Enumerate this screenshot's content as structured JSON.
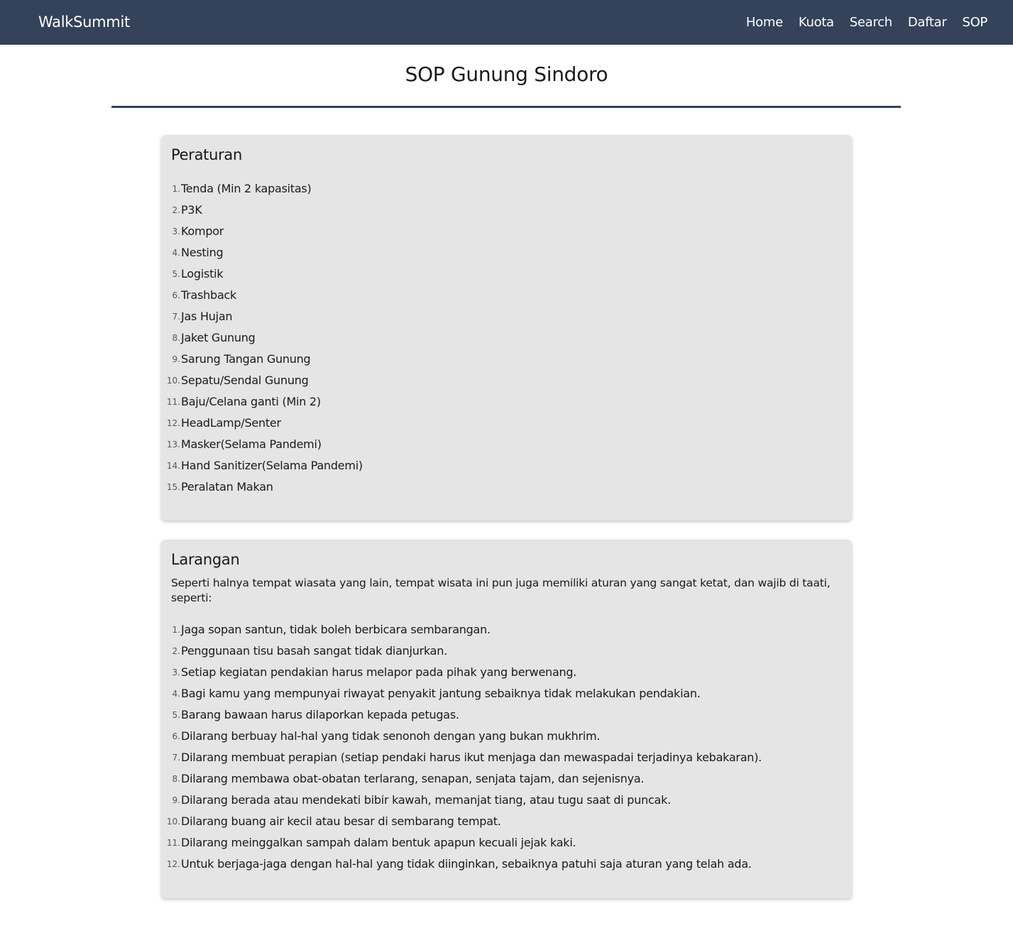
{
  "navbar": {
    "brand": "WalkSummit",
    "links": [
      "Home",
      "Kuota",
      "Search",
      "Daftar",
      "SOP"
    ]
  },
  "page": {
    "title": "SOP Gunung Sindoro"
  },
  "rules": {
    "title": "Peraturan",
    "items": [
      "Tenda (Min 2 kapasitas)",
      "P3K",
      "Kompor",
      "Nesting",
      "Logistik",
      "Trashback",
      "Jas Hujan",
      "Jaket Gunung",
      "Sarung Tangan Gunung",
      "Sepatu/Sendal Gunung",
      "Baju/Celana ganti (Min 2)",
      "HeadLamp/Senter",
      "Masker(Selama Pandemi)",
      "Hand Sanitizer(Selama Pandemi)",
      "Peralatan Makan"
    ]
  },
  "bans": {
    "title": "Larangan",
    "intro": "Seperti halnya tempat wiasata yang lain, tempat wisata ini pun juga memiliki aturan yang sangat ketat, dan wajib di taati, seperti:",
    "items": [
      "Jaga sopan santun, tidak boleh berbicara sembarangan.",
      "Penggunaan tisu basah sangat tidak dianjurkan.",
      "Setiap kegiatan pendakian harus melapor pada pihak yang berwenang.",
      "Bagi kamu yang mempunyai riwayat penyakit jantung sebaiknya tidak melakukan pendakian.",
      "Barang bawaan harus dilaporkan kepada petugas.",
      "Dilarang berbuay hal-hal yang tidak senonoh dengan yang bukan mukhrim.",
      "Dilarang membuat perapian (setiap pendaki harus ikut menjaga dan mewaspadai terjadinya kebakaran).",
      "Dilarang membawa obat-obatan terlarang, senapan, senjata tajam, dan sejenisnya.",
      "Dilarang berada atau mendekati bibir kawah, memanjat tiang, atau tugu saat di puncak.",
      "Dilarang buang air kecil atau besar di sembarang tempat.",
      "Dilarang meinggalkan sampah dalam bentuk apapun kecuali jejak kaki.",
      "Untuk berjaga-jaga dengan hal-hal yang tidak diinginkan, sebaiknya patuhi saja aturan yang telah ada."
    ]
  },
  "colors": {
    "navbar_bg": "#34425a",
    "card_bg": "#e5e5e5",
    "rule_line": "#34425a"
  }
}
